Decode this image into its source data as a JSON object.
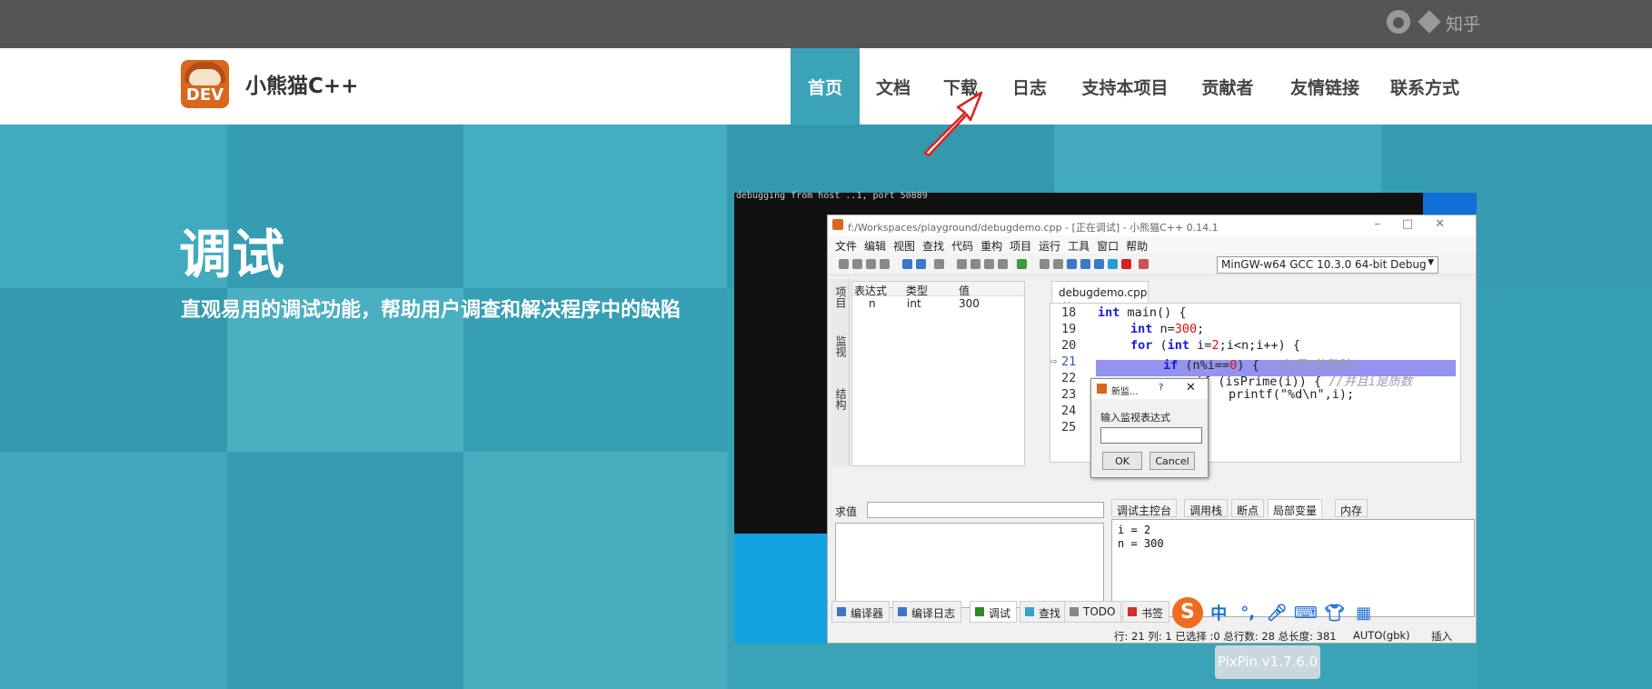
{
  "topbar": {
    "github_icon": "github-icon",
    "git_icon": "git-icon",
    "zhihu_label": "知乎"
  },
  "header": {
    "logo_text": "DEV",
    "brand": "小熊猫C++",
    "nav": [
      "首页",
      "文档",
      "下载",
      "日志",
      "支持本项目",
      "贡献者",
      "友情链接",
      "联系方式"
    ],
    "active_index": 0
  },
  "hero": {
    "title": "调试",
    "subtitle": "直观易用的调试功能，帮助用户调查和解决程序中的缺陷"
  },
  "colors": {
    "accent": "#3aa3b8",
    "topbar": "#555555",
    "brand_orange": "#d9671e"
  },
  "screenshot": {
    "console_text": "debugging from host ..1, port 50889",
    "title": "f:/Workspaces/playground/debugdemo.cpp - [正在调试] - 小熊猫C++ 0.14.1",
    "menu": [
      "文件",
      "编辑",
      "视图",
      "查找",
      "代码",
      "重构",
      "项目",
      "运行",
      "工具",
      "窗口",
      "帮助"
    ],
    "compiler": "MinGW-w64 GCC 10.3.0 64-bit Debug",
    "side_tabs": [
      "项目",
      "监视",
      "结构"
    ],
    "watch_headers": [
      "表达式",
      "类型",
      "值"
    ],
    "watch_row": {
      "expr": "n",
      "type": "int",
      "value": "300"
    },
    "editor_tab": "debugdemo.cpp",
    "line_numbers": [
      "18",
      "19",
      "20",
      "21",
      "22",
      "23",
      "24",
      "25"
    ],
    "code": {
      "l18_kw": "int",
      "l18": " main() {",
      "l19_kw": "int",
      "l19a": " n=",
      "l19_num": "300",
      "l19b": ";",
      "l20_kw": "for",
      "l20a": " (",
      "l20_kw2": "int",
      "l20b": " i=",
      "l20_num": "2",
      "l20c": ";i<n;i++) {",
      "l21_kw": "if",
      "l21a": " (n%i==",
      "l21_num": "0",
      "l21b": ") { ",
      "l21_cm": "//如果i能整除n",
      "l22a": "if (isPrime(i)) { ",
      "l22_cm": "//并且i是质数",
      "l23": "printf(\"%d\\n\",i);"
    },
    "dialog": {
      "title": "新监...",
      "help": "?",
      "close": "✕",
      "label": "输入监视表达式",
      "input_value": "",
      "ok": "OK",
      "cancel": "Cancel"
    },
    "eval_label": "求值",
    "debug_tabs": [
      "调试主控台",
      "调用栈",
      "断点",
      "局部变量",
      "内存"
    ],
    "locals": [
      "i = 2",
      "n = 300"
    ],
    "bottom_tabs": [
      "编译器",
      "编译日志",
      "调试",
      "查找",
      "TODO",
      "书签"
    ],
    "status": {
      "position": "行: 21 列: 1 已选择 :0 总行数: 28 总长度: 381",
      "encoding": "AUTO(gbk)",
      "mode": "插入"
    }
  },
  "ime": {
    "logo": "S",
    "zh": "中",
    "punct": "°,"
  },
  "pixpin_label": "PixPin v1.7.6.0"
}
